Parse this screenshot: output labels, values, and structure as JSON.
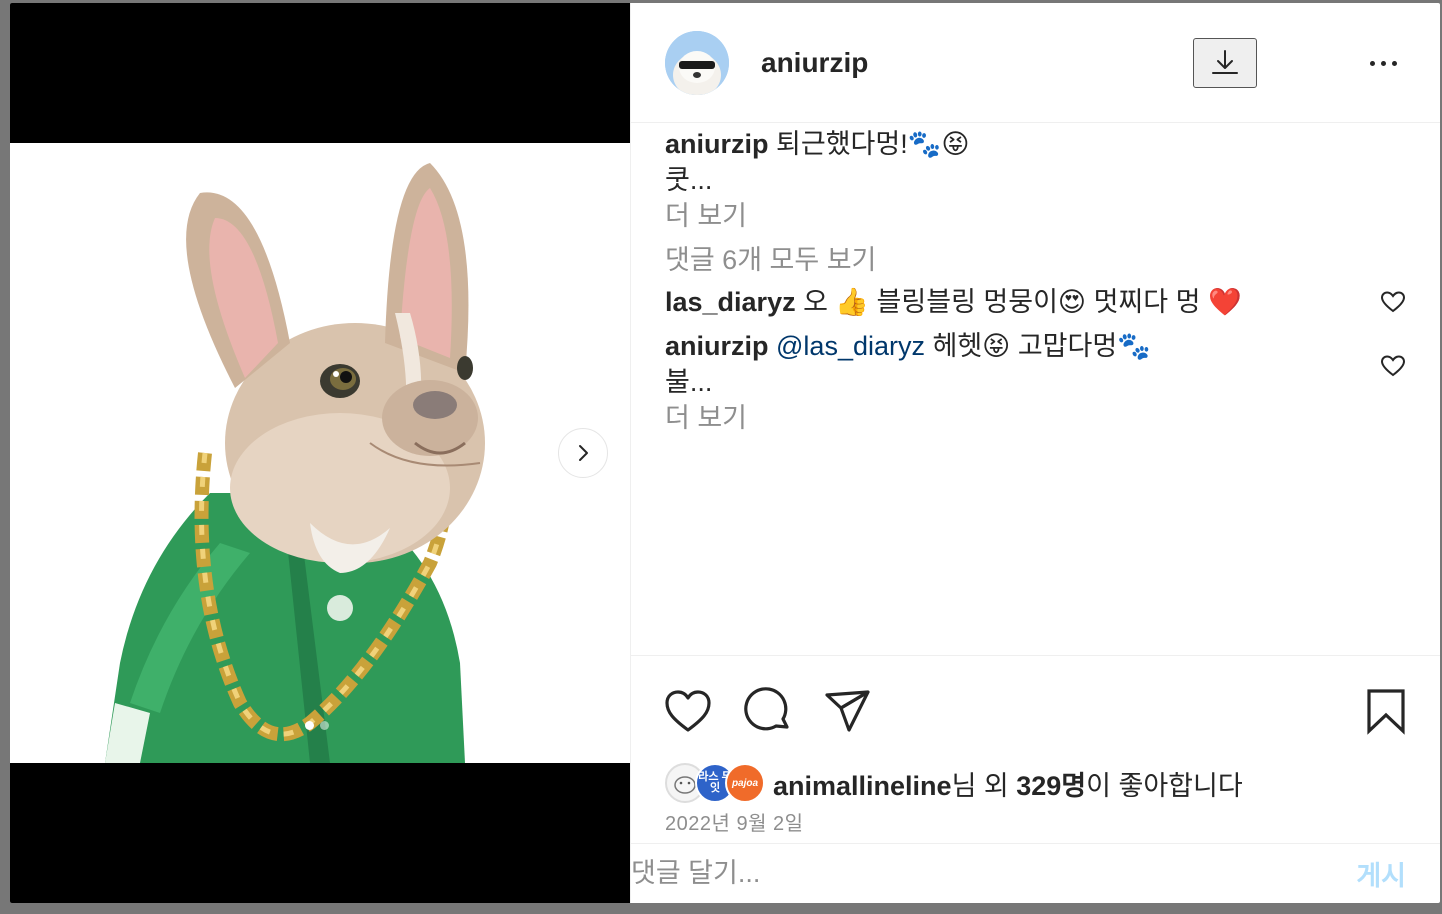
{
  "post": {
    "username": "aniurzip",
    "caption": {
      "username": "aniurzip",
      "text": " 퇴근했다멍!🐾😝",
      "truncated": "쿳...",
      "more": "더 보기"
    },
    "view_all_comments": "댓글 6개 모두 보기",
    "comments": [
      {
        "username": "las_diaryz",
        "text": " 오 👍 블링블링 멍뭉이😍 멋찌다 멍 ❤️"
      },
      {
        "username": "aniurzip",
        "mention": " @las_diaryz",
        "text": " 헤헷😝 고맙다멍🐾",
        "truncated": "불...",
        "more": "더 보기"
      }
    ],
    "likes": {
      "user": "animallineline",
      "suffix": "님 외 ",
      "count": "329명",
      "tail": "이 좋아합니다",
      "avatar2_text": "라스 두잇",
      "avatar3_text": "pajoa"
    },
    "date": "2022년 9월 2일",
    "comment_placeholder": "댓글 달기...",
    "post_button": "게시",
    "carousel": {
      "total": 2,
      "active": 1
    }
  },
  "icons": {
    "download": "download-icon",
    "more": "more-icon",
    "like": "heart-icon",
    "comment": "comment-icon",
    "share": "send-icon",
    "save": "bookmark-icon",
    "next": "chevron-right-icon"
  },
  "colors": {
    "text": "#262626",
    "muted": "#8e8e8e",
    "mention": "#00376b",
    "post_button": "#b2dffc"
  }
}
